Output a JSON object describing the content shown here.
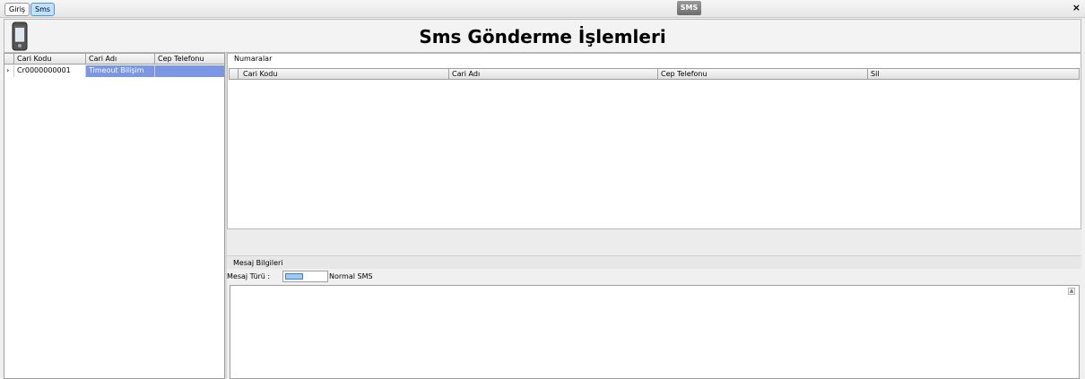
{
  "tabs": [
    {
      "label": "Giriş"
    },
    {
      "label": "Sms"
    }
  ],
  "app_badge": "SMS",
  "header": {
    "title": "Sms Gönderme İşlemleri"
  },
  "left_grid": {
    "columns": [
      "Cari Kodu",
      "Cari Adı",
      "Cep Telefonu"
    ],
    "rows": [
      {
        "code": "Cr0000000001",
        "name": "Timeout Bilişim",
        "phone": ""
      }
    ]
  },
  "numaralar": {
    "title": "Numaralar",
    "columns": [
      "Cari Kodu",
      "Cari Adı",
      "Cep Telefonu",
      "Sil"
    ]
  },
  "mesaj": {
    "title": "Mesaj Bilgileri",
    "type_label": "Mesaj Türü :",
    "type_value": "Normal SMS"
  },
  "colors": {
    "active_tab": "#bfe3ff",
    "selection": "#7b97e3"
  }
}
